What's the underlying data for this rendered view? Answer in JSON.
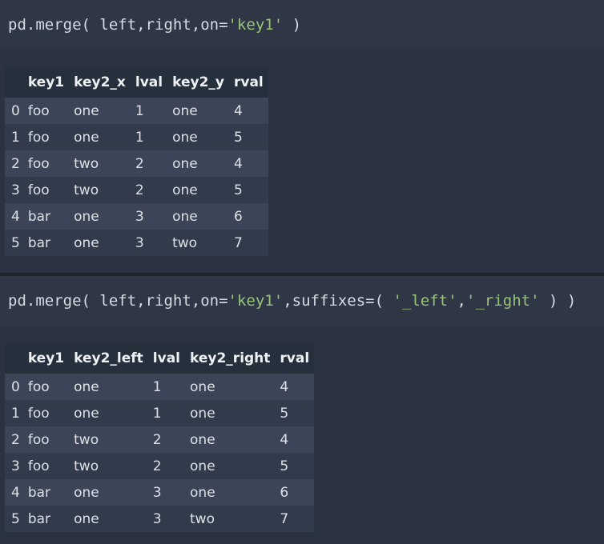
{
  "cell1": {
    "code_prefix": "pd.merge( left,right,on=",
    "code_str": "'key1'",
    "code_suffix": " )"
  },
  "table1": {
    "headers": [
      "",
      "key1",
      "key2_x",
      "lval",
      "key2_y",
      "rval"
    ],
    "rows": [
      [
        "0",
        "foo",
        "one",
        "1",
        "one",
        "4"
      ],
      [
        "1",
        "foo",
        "one",
        "1",
        "one",
        "5"
      ],
      [
        "2",
        "foo",
        "two",
        "2",
        "one",
        "4"
      ],
      [
        "3",
        "foo",
        "two",
        "2",
        "one",
        "5"
      ],
      [
        "4",
        "bar",
        "one",
        "3",
        "one",
        "6"
      ],
      [
        "5",
        "bar",
        "one",
        "3",
        "two",
        "7"
      ]
    ]
  },
  "cell2": {
    "code_prefix": "pd.merge( left,right,on=",
    "code_str1": "'key1'",
    "code_mid": ",suffixes=( ",
    "code_str2": "'_left'",
    "code_comma": ",",
    "code_str3": "'_right'",
    "code_suffix": " ) )"
  },
  "table2": {
    "headers": [
      "",
      "key1",
      "key2_left",
      "lval",
      "key2_right",
      "rval"
    ],
    "rows": [
      [
        "0",
        "foo",
        "one",
        "1",
        "one",
        "4"
      ],
      [
        "1",
        "foo",
        "one",
        "1",
        "one",
        "5"
      ],
      [
        "2",
        "foo",
        "two",
        "2",
        "one",
        "4"
      ],
      [
        "3",
        "foo",
        "two",
        "2",
        "one",
        "5"
      ],
      [
        "4",
        "bar",
        "one",
        "3",
        "one",
        "6"
      ],
      [
        "5",
        "bar",
        "one",
        "3",
        "two",
        "7"
      ]
    ]
  }
}
